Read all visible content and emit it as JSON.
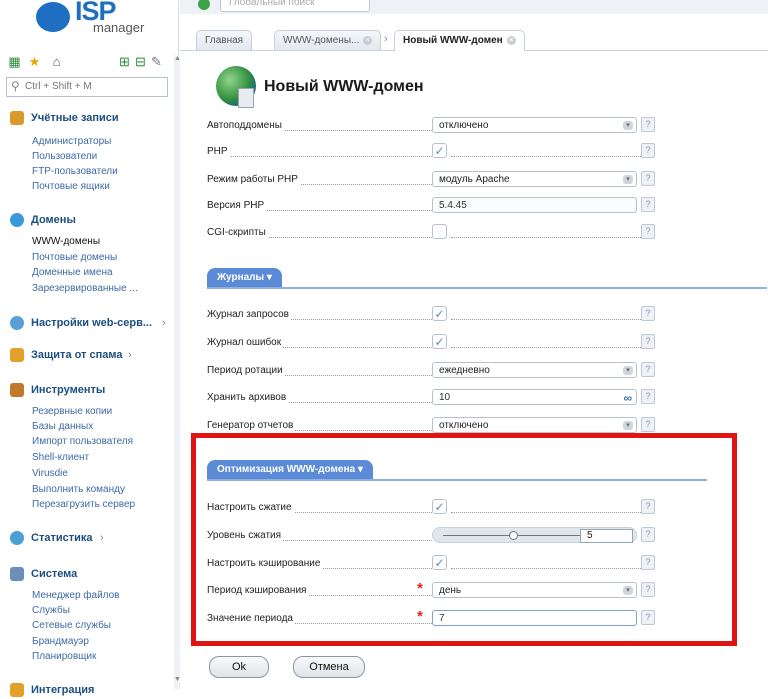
{
  "logo": {
    "brand": "ISP",
    "sub": "manager"
  },
  "sidebar": {
    "search_placeholder": "Ctrl + Shift + M",
    "sections": [
      {
        "title": "Учётные записи",
        "icon": "users-icon",
        "items": [
          "Администраторы",
          "Пользователи",
          "FTP-пользователи",
          "Почтовые ящики"
        ]
      },
      {
        "title": "Домены",
        "icon": "globe-icon",
        "items": [
          "WWW-домены",
          "Почтовые домены",
          "Доменные имена",
          "Зарезервированные ..."
        ]
      },
      {
        "title": "Настройки web-серв...",
        "icon": "web-settings-icon",
        "items": []
      },
      {
        "title": "Защита от спама",
        "icon": "shield-icon",
        "items": []
      },
      {
        "title": "Инструменты",
        "icon": "tools-icon",
        "items": [
          "Резервные копии",
          "Базы данных",
          "Импорт пользователя",
          "Shell-клиент",
          "Virusdie",
          "Выполнить команду",
          "Перезагрузить сервер"
        ]
      },
      {
        "title": "Статистика",
        "icon": "stats-icon",
        "items": []
      },
      {
        "title": "Система",
        "icon": "system-icon",
        "items": [
          "Менеджер файлов",
          "Службы",
          "Сетевые службы",
          "Брандмауэр",
          "Планировщик"
        ]
      },
      {
        "title": "Интеграция",
        "icon": "integration-icon",
        "items": []
      }
    ]
  },
  "topbar": {
    "global_search_placeholder": "Глобальный поиск"
  },
  "tabs": [
    {
      "label": "Главная"
    },
    {
      "label": "WWW-домены..."
    },
    {
      "label": "Новый WWW-домен"
    }
  ],
  "page": {
    "title": "Новый WWW-домен"
  },
  "form": {
    "general": [
      {
        "label": "Автоподдомены",
        "type": "select",
        "value": "отключено"
      },
      {
        "label": "PHP",
        "type": "checkbox",
        "value": "✓"
      },
      {
        "label": "Режим работы PHP",
        "type": "select",
        "value": "модуль Apache"
      },
      {
        "label": "Версия PHP",
        "type": "text",
        "value": "5.4.45"
      },
      {
        "label": "CGI-скрипты",
        "type": "checkbox",
        "value": ""
      }
    ],
    "logs_section": "Журналы",
    "logs": [
      {
        "label": "Журнал запросов",
        "type": "checkbox",
        "value": "✓"
      },
      {
        "label": "Журнал ошибок",
        "type": "checkbox",
        "value": "✓"
      },
      {
        "label": "Период ротации",
        "type": "select",
        "value": "ежедневно"
      },
      {
        "label": "Хранить архивов",
        "type": "text",
        "value": "10",
        "suffix": "∞"
      },
      {
        "label": "Генератор отчетов",
        "type": "select",
        "value": "отключено"
      }
    ],
    "opt_section": "Оптимизация WWW-домена",
    "optimization": [
      {
        "label": "Настроить сжатие",
        "type": "checkbox",
        "value": "✓"
      },
      {
        "label": "Уровень сжатия",
        "type": "slider",
        "value": "5"
      },
      {
        "label": "Настроить кэширование",
        "type": "checkbox",
        "value": "✓"
      },
      {
        "label": "Период кэширования",
        "type": "select",
        "value": "день",
        "required": true
      },
      {
        "label": "Значение периода",
        "type": "text",
        "value": "7",
        "required": true
      }
    ],
    "help_glyph": "?",
    "required_glyph": "*",
    "dropdown_glyph": "▾"
  },
  "buttons": {
    "ok": "Ok",
    "cancel": "Отмена"
  },
  "colors": {
    "accent": "#5b8ad6",
    "highlight_border": "#e11414",
    "link": "#3e6aa6"
  }
}
